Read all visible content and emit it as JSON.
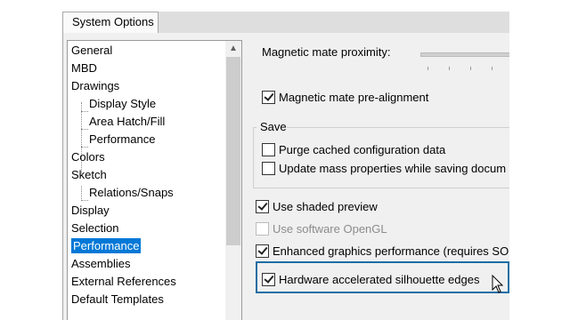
{
  "dialog": {
    "tab_label": "System Options"
  },
  "tree": {
    "items": [
      {
        "label": "General",
        "child": false,
        "selected": false
      },
      {
        "label": "MBD",
        "child": false,
        "selected": false
      },
      {
        "label": "Drawings",
        "child": false,
        "selected": false
      },
      {
        "label": "Display Style",
        "child": true,
        "selected": false
      },
      {
        "label": "Area Hatch/Fill",
        "child": true,
        "selected": false
      },
      {
        "label": "Performance",
        "child": true,
        "selected": false
      },
      {
        "label": "Colors",
        "child": false,
        "selected": false
      },
      {
        "label": "Sketch",
        "child": false,
        "selected": false
      },
      {
        "label": "Relations/Snaps",
        "child": true,
        "selected": false
      },
      {
        "label": "Display",
        "child": false,
        "selected": false
      },
      {
        "label": "Selection",
        "child": false,
        "selected": false
      },
      {
        "label": "Performance",
        "child": false,
        "selected": true
      },
      {
        "label": "Assemblies",
        "child": false,
        "selected": false
      },
      {
        "label": "External References",
        "child": false,
        "selected": false
      },
      {
        "label": "Default Templates",
        "child": false,
        "selected": false
      }
    ],
    "scroll_up_icon": "chevron-up-icon"
  },
  "options": {
    "magnetic_proximity_label": "Magnetic mate proximity:",
    "magnetic_prealign": {
      "label": "Magnetic mate pre-alignment",
      "checked": true
    },
    "save_group_label": "Save",
    "purge_cached": {
      "label": "Purge cached configuration data",
      "checked": false
    },
    "update_mass": {
      "label": "Update mass properties while saving docum",
      "checked": false
    },
    "use_shaded_preview": {
      "label": "Use shaded preview",
      "checked": true
    },
    "use_software_opengl": {
      "label": "Use software OpenGL",
      "checked": false,
      "disabled": true
    },
    "enhanced_graphics": {
      "label": "Enhanced graphics performance (requires SO",
      "checked": true
    },
    "hardware_silhouette": {
      "label": "Hardware accelerated silhouette edges",
      "checked": true
    }
  },
  "colors": {
    "selection": "#0078d7",
    "highlight_border": "#1c6ea4"
  }
}
